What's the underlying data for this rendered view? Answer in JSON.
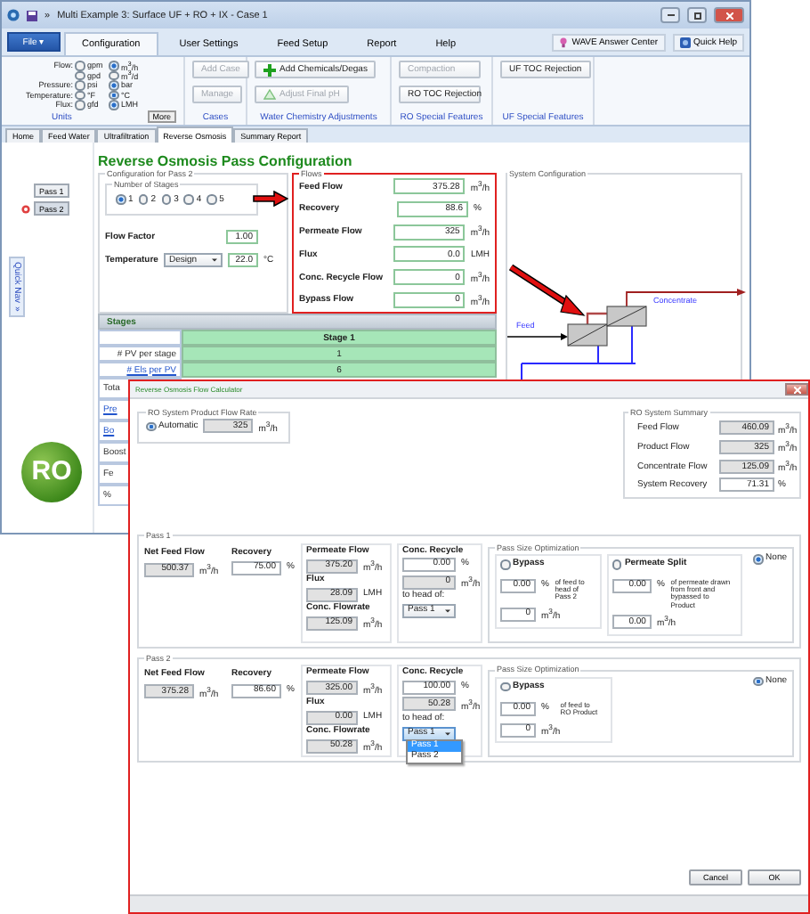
{
  "window": {
    "title": "Multi Example 3: Surface UF + RO + IX - Case 1",
    "overflow": "»"
  },
  "ribbon": {
    "file_button": "File ▾",
    "tabs": [
      {
        "label": "Configuration",
        "selected": true
      },
      {
        "label": "User Settings",
        "selected": false
      },
      {
        "label": "Feed Setup",
        "selected": false
      },
      {
        "label": "Report",
        "selected": false
      },
      {
        "label": "Help",
        "selected": false
      }
    ],
    "links": [
      "WAVE Answer Center",
      "Quick Help"
    ],
    "units": {
      "caption": "Units",
      "more": "More",
      "rows": [
        {
          "label": "Flow:",
          "options": [
            {
              "label": "gpm",
              "selected": false
            },
            {
              "label": "m$^{3}$/h",
              "selected": true
            }
          ]
        },
        {
          "options": [
            {
              "label": "gpd",
              "selected": false
            },
            {
              "label": "m$^{3}$/d",
              "selected": false
            }
          ]
        },
        {
          "label": "Pressure:",
          "options": [
            {
              "label": "psi",
              "selected": false
            },
            {
              "label": "bar",
              "selected": true
            }
          ]
        },
        {
          "label": "Temperature:",
          "options": [
            {
              "label": "°F",
              "selected": false
            },
            {
              "label": "°C",
              "selected": true
            }
          ]
        },
        {
          "label": "Flux:",
          "options": [
            {
              "label": "gfd",
              "selected": false
            },
            {
              "label": "LMH",
              "selected": true
            }
          ]
        }
      ]
    },
    "groups": [
      {
        "caption": "Cases",
        "buttons": [
          {
            "label": "Add Case",
            "kind": "plain",
            "disabled": true
          },
          {
            "label": "Manage",
            "kind": "plain",
            "disabled": true
          }
        ]
      },
      {
        "caption": "Water Chemistry Adjustments",
        "buttons": [
          {
            "label": "Add Chemicals/Degas",
            "kind": "add",
            "disabled": false
          },
          {
            "label": "Adjust Final pH",
            "kind": "adjust",
            "disabled": true
          }
        ]
      },
      {
        "caption": "RO Special Features",
        "buttons": [
          {
            "label": "Compaction",
            "kind": "plain",
            "disabled": true
          },
          {
            "label": "RO TOC Rejection",
            "kind": "plain",
            "disabled": false
          }
        ]
      },
      {
        "caption": "UF Special Features",
        "buttons": [
          {
            "label": "UF TOC Rejection",
            "kind": "plain",
            "disabled": false
          }
        ]
      }
    ]
  },
  "page_tabs": [
    {
      "label": "Home",
      "selected": false
    },
    {
      "label": "Feed Water",
      "selected": false
    },
    {
      "label": "Ultrafiltration",
      "selected": false
    },
    {
      "label": "Reverse Osmosis",
      "selected": true
    },
    {
      "label": "Summary Report",
      "selected": false
    }
  ],
  "side": {
    "passes": [
      {
        "label": "Pass 1",
        "selected": false
      },
      {
        "label": "Pass 2",
        "selected": true
      }
    ],
    "quick_nav": "Quick Nav",
    "quick_nav_arrow": "»",
    "logo": "RO"
  },
  "content": {
    "title": "Reverse Osmosis Pass Configuration",
    "config": {
      "caption": "Configuration for Pass 2",
      "stages_caption": "Number of Stages",
      "stages": [
        {
          "label": "1",
          "selected": true
        },
        {
          "label": "2",
          "selected": false
        },
        {
          "label": "3",
          "selected": false
        },
        {
          "label": "4",
          "selected": false
        },
        {
          "label": "5",
          "selected": false
        }
      ],
      "flow_factor": {
        "label": "Flow Factor",
        "value": "1.00"
      },
      "temperature": {
        "label": "Temperature",
        "select": "Design",
        "value": "22.0",
        "unit": "°C"
      }
    },
    "flows": {
      "caption": "Flows",
      "rows": [
        {
          "label": "Feed Flow",
          "value": "375.28",
          "unit": "m$^{3}$/h"
        },
        {
          "label": "Recovery",
          "value": "88.6",
          "unit": "%"
        },
        {
          "label": "Permeate Flow",
          "value": "325",
          "unit": "m$^{3}$/h"
        },
        {
          "label": "Flux",
          "value": "0.0",
          "unit": "LMH"
        },
        {
          "label": "Conc. Recycle Flow",
          "value": "0",
          "unit": "m$^{3}$/h"
        },
        {
          "label": "Bypass Flow",
          "value": "0",
          "unit": "m$^{3}$/h"
        }
      ]
    },
    "system": {
      "caption": "System Configuration",
      "feed": "Feed",
      "concentrate": "Concentrate"
    },
    "stages_table": {
      "caption": "Stages",
      "column": "Stage 1",
      "rows": [
        {
          "label": "# PV per stage",
          "value": "1",
          "link": false
        },
        {
          "label": "# Els per PV",
          "value": "6",
          "link": true
        },
        {
          "label": "Tota",
          "link": false
        },
        {
          "label": "Pre",
          "link": true
        },
        {
          "label": "Bo",
          "link": true
        },
        {
          "label": "Boost",
          "link": false
        },
        {
          "label": "Fe",
          "link": false
        },
        {
          "label": "%",
          "link": false
        }
      ]
    }
  },
  "dialog": {
    "title": "Reverse Osmosis Flow Calculator",
    "product_rate": {
      "caption": "RO System Product Flow Rate",
      "option": {
        "label": "Automatic",
        "selected": true
      },
      "value": "325",
      "unit": "m$^{3}$/h"
    },
    "summary": {
      "caption": "RO System Summary",
      "rows": [
        {
          "label": "Feed Flow",
          "value": "460.09",
          "unit": "m$^{3}$/h",
          "editable": false
        },
        {
          "label": "Product Flow",
          "value": "325",
          "unit": "m$^{3}$/h",
          "editable": false
        },
        {
          "label": "Concentrate Flow",
          "value": "125.09",
          "unit": "m$^{3}$/h",
          "editable": false
        },
        {
          "label": "System Recovery",
          "value": "71.31",
          "unit": "%",
          "editable": true
        }
      ]
    },
    "passes": [
      {
        "caption": "Pass 1",
        "net_feed": {
          "label": "Net Feed Flow",
          "value": "500.37",
          "unit": "m$^{3}$/h",
          "editable": false
        },
        "recovery": {
          "label": "Recovery",
          "value": "75.00",
          "unit": "%",
          "editable": true
        },
        "permeate": {
          "label": "Permeate Flow",
          "value": "375.20",
          "unit": "m$^{3}$/h",
          "editable": false
        },
        "flux": {
          "label": "Flux",
          "value": "28.09",
          "unit": "LMH",
          "editable": false
        },
        "conc_flow": {
          "label": "Conc. Flowrate",
          "value": "125.09",
          "unit": "m$^{3}$/h",
          "editable": false
        },
        "recycle": {
          "label": "Conc. Recycle",
          "percent": {
            "value": "0.00",
            "unit": "%",
            "editable": true
          },
          "flow": {
            "value": "0",
            "unit": "m$^{3}$/h",
            "editable": false
          },
          "head_label": "to head of:",
          "select": "Pass 1"
        },
        "optimization": {
          "caption": "Pass Size Optimization",
          "choices": [
            {
              "kind": "bypass",
              "label": "Bypass",
              "selected": false,
              "percent": "0.00",
              "percent_unit": "%",
              "note": "of feed to head of Pass 2",
              "flow": "0",
              "unit": "m$^{3}$/h"
            },
            {
              "kind": "split",
              "label": "Permeate Split",
              "selected": false,
              "percent": "0.00",
              "percent_unit": "%",
              "note": "of permeate drawn from front and bypassed to Product",
              "flow": "0.00",
              "unit": "m$^{3}$/h"
            }
          ],
          "none": {
            "label": "None",
            "selected": true
          }
        }
      },
      {
        "caption": "Pass 2",
        "net_feed": {
          "label": "Net Feed Flow",
          "value": "375.28",
          "unit": "m$^{3}$/h",
          "editable": false
        },
        "recovery": {
          "label": "Recovery",
          "value": "86.60",
          "unit": "%",
          "editable": true
        },
        "permeate": {
          "label": "Permeate Flow",
          "value": "325.00",
          "unit": "m$^{3}$/h",
          "editable": false
        },
        "flux": {
          "label": "Flux",
          "value": "0.00",
          "unit": "LMH",
          "editable": false
        },
        "conc_flow": {
          "label": "Conc. Flowrate",
          "value": "50.28",
          "unit": "m$^{3}$/h",
          "editable": false
        },
        "recycle": {
          "label": "Conc. Recycle",
          "percent": {
            "value": "100.00",
            "unit": "%",
            "editable": true
          },
          "flow": {
            "value": "50.28",
            "unit": "m$^{3}$/h",
            "editable": false
          },
          "head_label": "to head of:",
          "select": "Pass 1",
          "dropdown": [
            {
              "label": "Pass 1",
              "selected": true
            },
            {
              "label": "Pass 2",
              "selected": false
            }
          ]
        },
        "optimization": {
          "caption": "Pass Size Optimization",
          "choices": [
            {
              "kind": "bypass",
              "label": "Bypass",
              "selected": false,
              "percent": "0.00",
              "percent_unit": "%",
              "note": "of feed to RO Product",
              "flow": "0",
              "unit": "m$^{3}$/h"
            }
          ],
          "none": {
            "label": "None",
            "selected": true
          }
        }
      }
    ],
    "buttons": [
      "Cancel",
      "OK"
    ]
  }
}
